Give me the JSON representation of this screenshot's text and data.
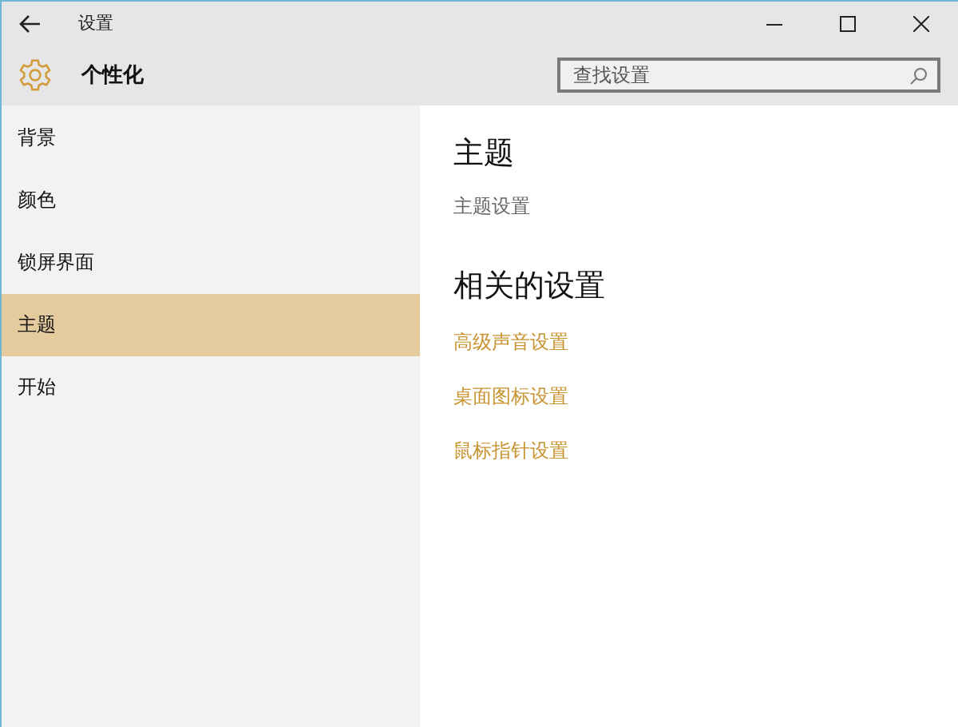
{
  "window": {
    "title": "设置"
  },
  "header": {
    "title": "个性化",
    "search": {
      "placeholder": "查找设置"
    }
  },
  "sidebar": {
    "items": [
      {
        "label": "背景",
        "selected": false
      },
      {
        "label": "颜色",
        "selected": false
      },
      {
        "label": "锁屏界面",
        "selected": false
      },
      {
        "label": "主题",
        "selected": true
      },
      {
        "label": "开始",
        "selected": false
      }
    ]
  },
  "content": {
    "title": "主题",
    "subtitle": "主题设置",
    "related_title": "相关的设置",
    "links": [
      {
        "label": "高级声音设置"
      },
      {
        "label": "桌面图标设置"
      },
      {
        "label": "鼠标指针设置"
      }
    ]
  }
}
